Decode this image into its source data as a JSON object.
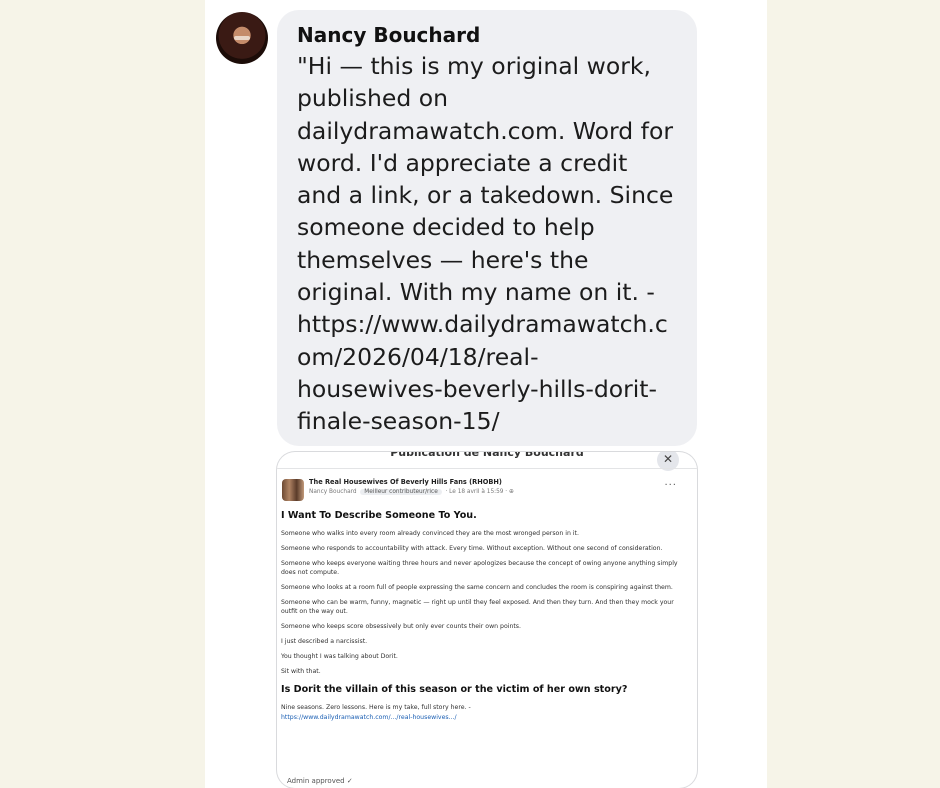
{
  "comment": {
    "author": "Nancy Bouchard",
    "text": "\"Hi — this is my original work, published on dailydramawatch.com. Word for word. I'd appreciate a credit and a link, or a takedown. Since someone decided to help themselves — here's the original. With my name on it. - https://www.dailydramawatch.com/2026/04/18/real-housewives-beverly-hills-dorit-finale-season-15/"
  },
  "embedded_post": {
    "header": "Publication de Nancy Bouchard",
    "close_icon": "close-icon",
    "group_name": "The Real Housewives Of Beverly Hills Fans (RHOBH)",
    "author": "Nancy Bouchard",
    "badge": "Meilleur contributeur/rice",
    "timestamp": "· Le 18 avril à 15:59 · ⊕",
    "more_icon": "more-icon",
    "title": "I Want To Describe Someone To You.",
    "paragraphs": [
      "Someone who walks into every room already convinced they are the most wronged person in it.",
      "Someone who responds to accountability with attack. Every time. Without exception. Without one second of consideration.",
      "Someone who keeps everyone waiting three hours and never apologizes because the concept of owing anyone anything simply does not compute.",
      "Someone who looks at a room full of people expressing the same concern and concludes the room is conspiring against them.",
      "Someone who can be warm, funny, magnetic — right up until they feel exposed. And then they turn. And then they mock your outfit on the way out.",
      "Someone who keeps score obsessively but only ever counts their own points.",
      "I just described a narcissist.",
      "You thought I was talking about Dorit.",
      "Sit with that."
    ],
    "subheading": "Is Dorit the villain of this season or the victim of her own story?",
    "closing": "Nine seasons. Zero lessons. Here is my take, full story here. -",
    "link": "https://www.dailydramawatch.com/.../real-housewives.../",
    "admin_note": "Admin approved ✓"
  }
}
